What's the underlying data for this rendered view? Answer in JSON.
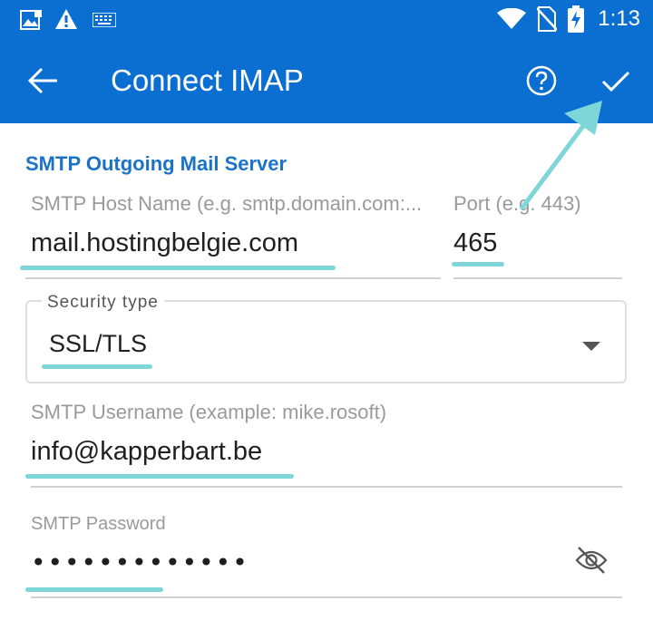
{
  "status_bar": {
    "time": "1:13",
    "icons": [
      "image-notification-icon",
      "warning-icon",
      "keyboard-icon",
      "wifi-icon",
      "no-sim-icon",
      "battery-charging-icon"
    ]
  },
  "app_bar": {
    "title": "Connect IMAP",
    "back_icon": "arrow-left-icon",
    "help_icon": "question-circle-icon",
    "confirm_icon": "checkmark-icon",
    "background_color": "#0a6fd1"
  },
  "smtp": {
    "section_title": "SMTP Outgoing Mail Server",
    "host": {
      "label": "SMTP Host Name (e.g. smtp.domain.com:...",
      "value": "mail.hostingbelgie.com"
    },
    "port": {
      "label": "Port (e.g. 443)",
      "value": "465"
    },
    "security": {
      "label": "Security type",
      "value": "SSL/TLS"
    },
    "username": {
      "label": "SMTP Username (example: mike.rosoft)",
      "value": "info@kapperbart.be"
    },
    "password": {
      "label": "SMTP Password",
      "value": "•••••••••••••",
      "visibility_icon": "eye-off-icon"
    }
  },
  "colors": {
    "accent": "#1a73c8",
    "highlight": "#7fd6d8",
    "pointer": "#7fd6d8"
  }
}
